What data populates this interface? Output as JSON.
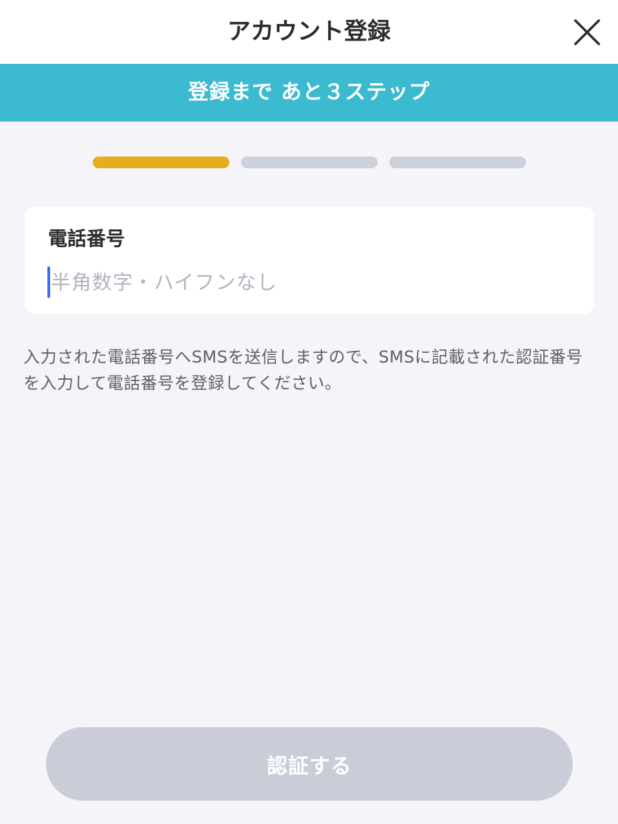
{
  "header": {
    "title": "アカウント登録",
    "close_icon": "close-icon"
  },
  "banner": {
    "text": "登録まで あと３ステップ",
    "color": "#3cbacf"
  },
  "progress": {
    "total_steps": 3,
    "current_step": 1,
    "active_color": "#e6ad1c",
    "inactive_color": "#cdd1dc"
  },
  "phone_field": {
    "label": "電話番号",
    "value": "",
    "placeholder": "半角数字・ハイフンなし"
  },
  "helper_text": "入力された電話番号へSMSを送信しますので、SMSに記載された認証番号を入力して電話番号を登録してください。",
  "submit": {
    "label": "認証する",
    "enabled": false
  }
}
